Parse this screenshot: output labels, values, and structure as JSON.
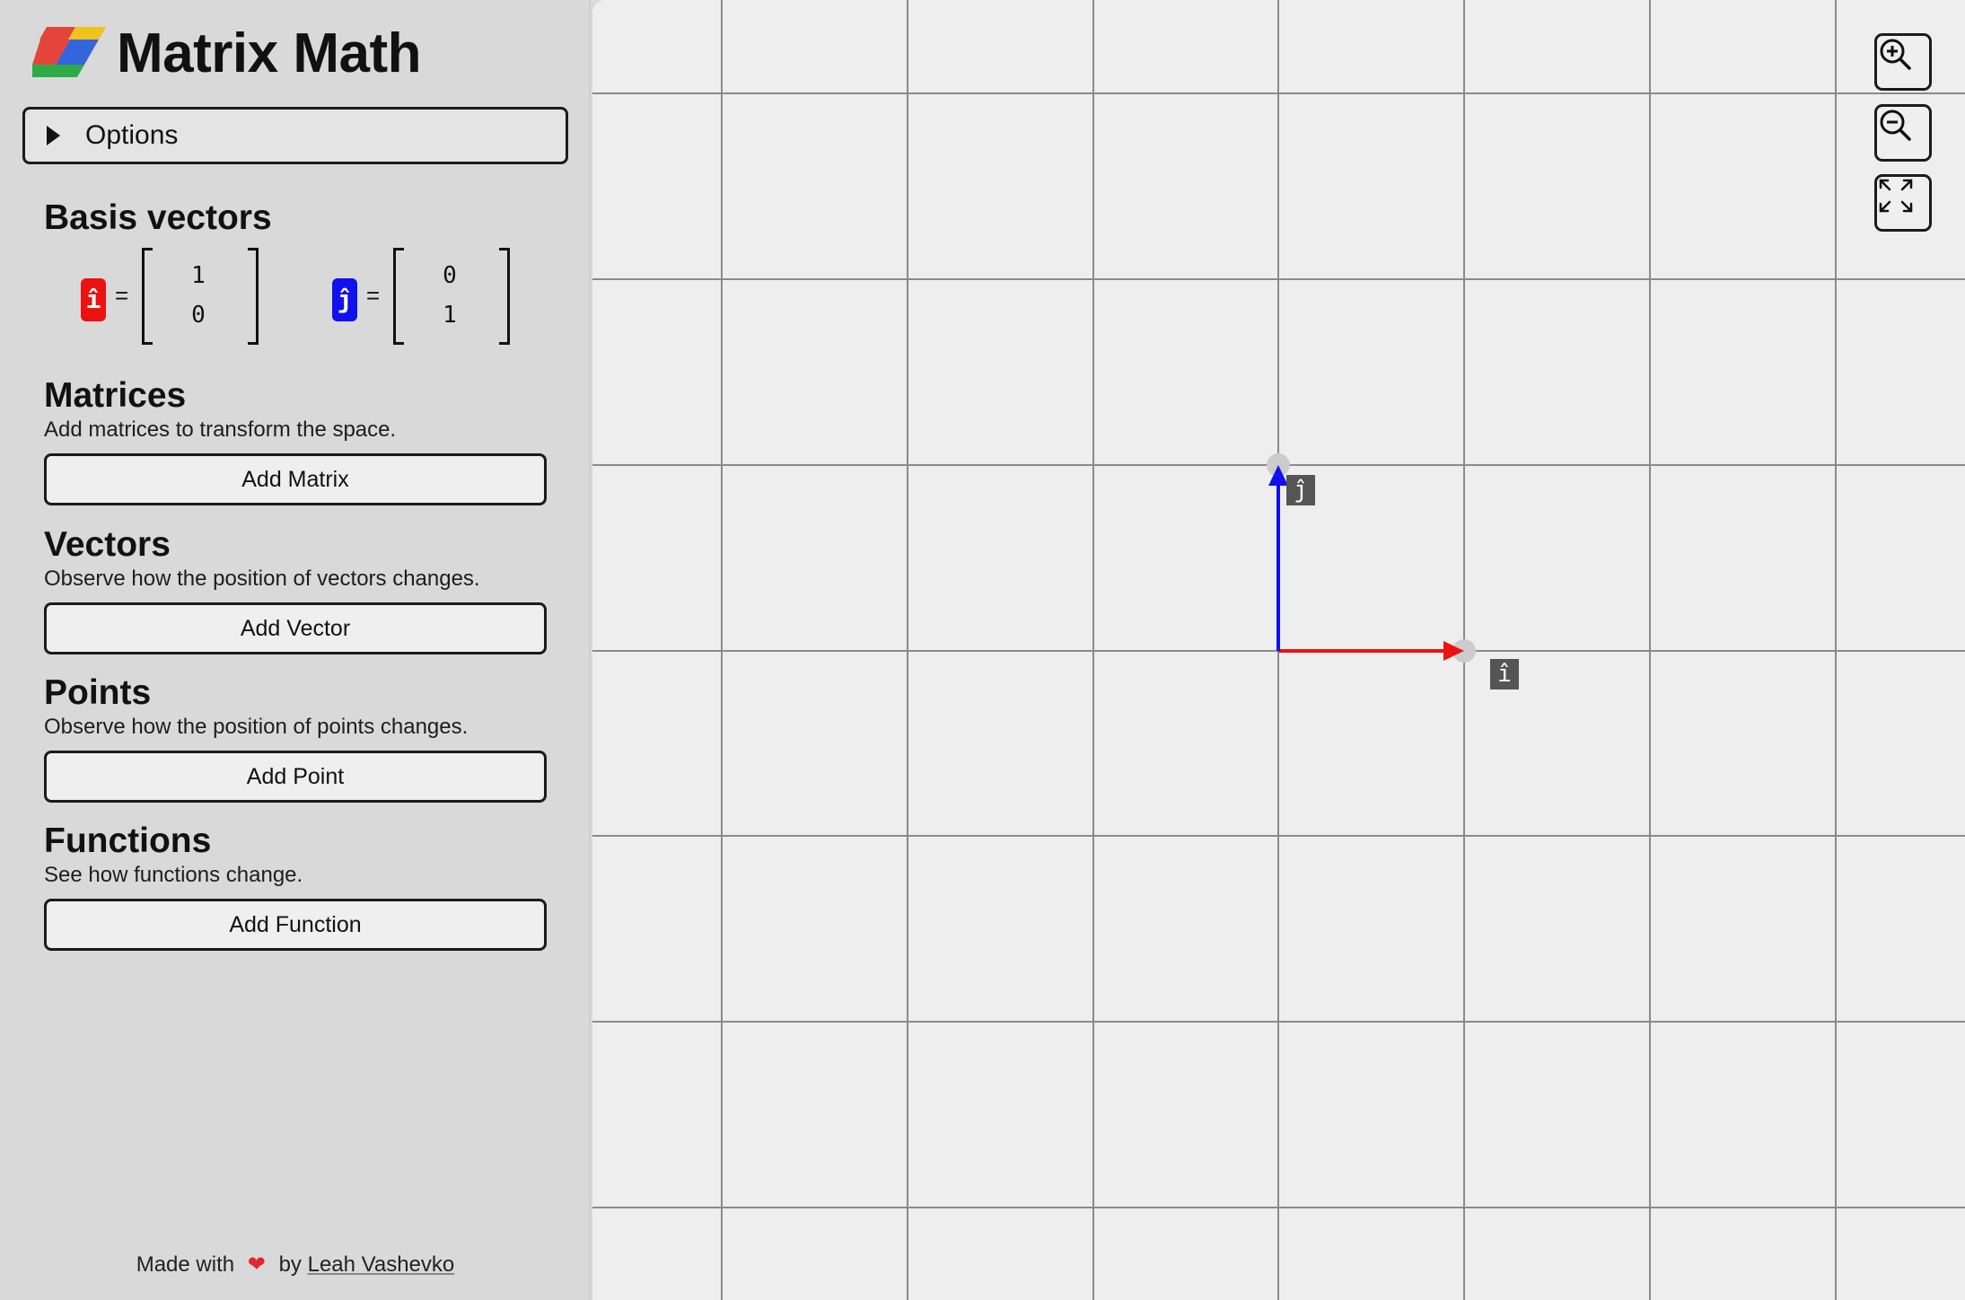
{
  "app": {
    "title": "Matrix Math",
    "logo_icon": "parallelogram-color-logo"
  },
  "options": {
    "label": "Options",
    "icon": "triangle-right-icon"
  },
  "basis": {
    "title": "Basis vectors",
    "i": {
      "symbol": "î",
      "color": "#ee1111",
      "eq": "=",
      "x": "1",
      "y": "0"
    },
    "j": {
      "symbol": "ĵ",
      "color": "#1111ee",
      "eq": "=",
      "x": "0",
      "y": "1"
    }
  },
  "matrices": {
    "title": "Matrices",
    "desc": "Add matrices to transform the space.",
    "button": "Add Matrix"
  },
  "vectors": {
    "title": "Vectors",
    "desc": "Observe how the position of vectors changes.",
    "button": "Add Vector"
  },
  "points": {
    "title": "Points",
    "desc": "Observe how the position of points changes.",
    "button": "Add Point"
  },
  "functions": {
    "title": "Functions",
    "desc": "See how functions change.",
    "button": "Add Function"
  },
  "footer": {
    "made_with": "Made with",
    "heart": "❤",
    "by": "by",
    "author": "Leah Vashevko"
  },
  "canvas": {
    "zoom_in_icon": "zoom-in-icon",
    "zoom_out_icon": "zoom-out-icon",
    "fit_icon": "fullscreen-expand-icon",
    "grid_color": "#8a8a8a",
    "i_label": "î",
    "j_label": "ĵ",
    "i_vector": {
      "x": 1,
      "y": 0,
      "color": "#ee1111"
    },
    "j_vector": {
      "x": 0,
      "y": 1,
      "color": "#1111ee"
    }
  }
}
